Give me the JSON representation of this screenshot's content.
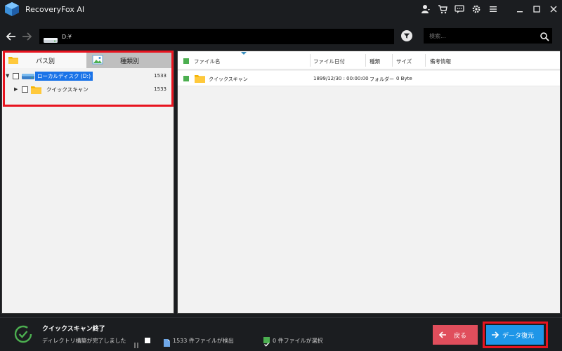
{
  "titlebar": {
    "app_title": "RecoveryFox AI"
  },
  "toolbar": {
    "path": "D:¥",
    "search_placeholder": "検索..."
  },
  "left_panel": {
    "tabs": [
      {
        "label": "パス別"
      },
      {
        "label": "種類別"
      }
    ],
    "tree": [
      {
        "label": "ローカルディスク (D:)",
        "count": "1533",
        "selected": true
      },
      {
        "label": "クイックスキャン",
        "count": "1533",
        "selected": false
      }
    ]
  },
  "table": {
    "columns": [
      "ファイル名",
      "ファイル日付",
      "種類",
      "サイズ",
      "備考情報"
    ],
    "rows": [
      {
        "name": "クイックスキャン",
        "date": "1899/12/30 : 00:00:00",
        "type": "フォルダー",
        "size": "0 Byte",
        "note": ""
      }
    ]
  },
  "footer": {
    "status_title": "クイックスキャン終了",
    "status_sub": "ディレクトリ構築が完了しました",
    "found": "1533 件ファイルが検出",
    "selected": "0 件ファイルが選択",
    "back_label": "戻る",
    "recover_label": "データ復元"
  },
  "colors": {
    "accent": "#1e96e8",
    "back": "#e04e5c",
    "highlight": "#e8141f",
    "check": "#4caf50"
  }
}
